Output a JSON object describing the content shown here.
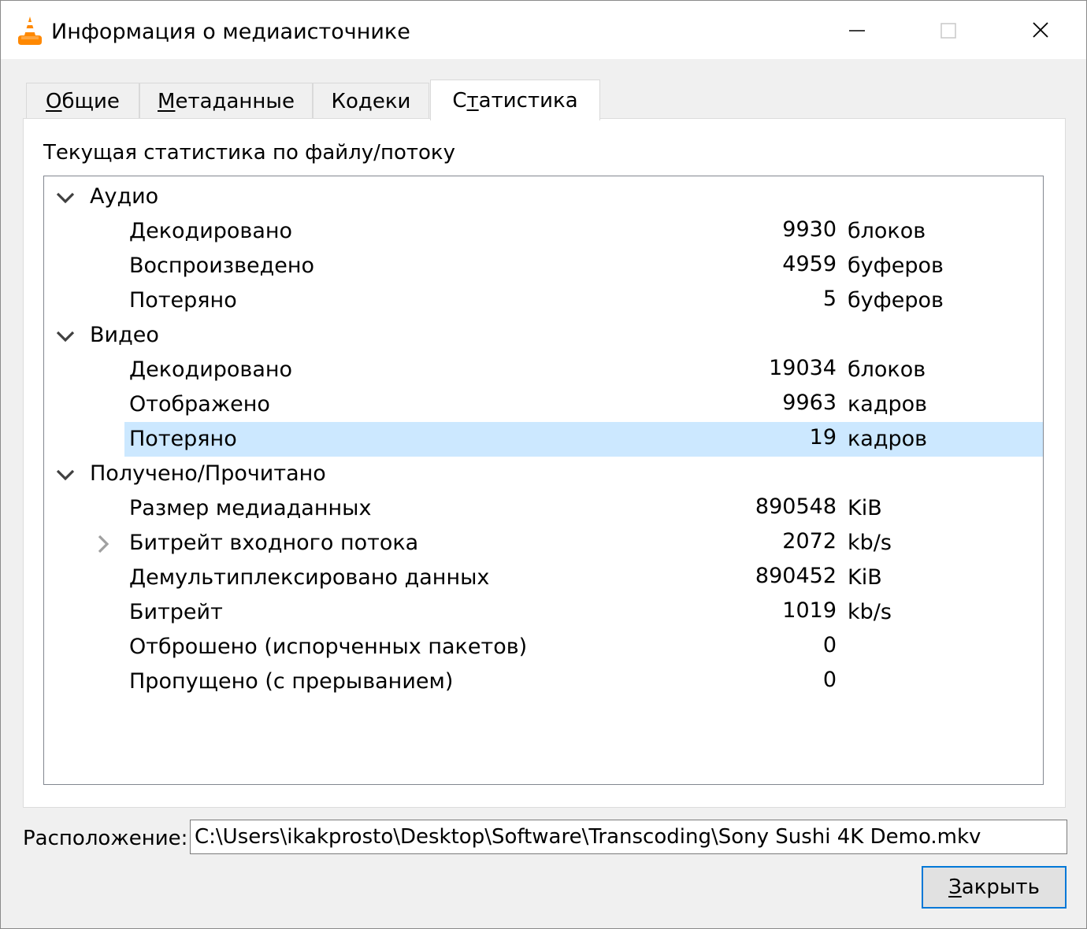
{
  "window": {
    "title": "Информация о медиаисточнике",
    "app_icon": "vlc-cone-icon",
    "buttons": [
      "minimize-icon",
      "maximize-icon",
      "close-icon"
    ]
  },
  "tabs": [
    {
      "mnemonic": "О",
      "rest": "бщие",
      "active": false
    },
    {
      "mnemonic": "М",
      "rest": "етаданные",
      "active": false
    },
    {
      "mnemonic": "",
      "rest": "Кодеки",
      "active": false
    },
    {
      "pre": "С",
      "mnemonic": "т",
      "rest": "атистика",
      "active": true
    }
  ],
  "stats": {
    "heading": "Текущая статистика по файлу/потоку",
    "groups": [
      {
        "label": "Аудио",
        "expanded": true,
        "items": [
          {
            "label": "Декодировано",
            "value": "9930",
            "unit": "блоков"
          },
          {
            "label": "Воспроизведено",
            "value": "4959",
            "unit": "буферов"
          },
          {
            "label": "Потеряно",
            "value": "5",
            "unit": "буферов"
          }
        ]
      },
      {
        "label": "Видео",
        "expanded": true,
        "items": [
          {
            "label": "Декодировано",
            "value": "19034",
            "unit": "блоков"
          },
          {
            "label": "Отображено",
            "value": "9963",
            "unit": "кадров"
          },
          {
            "label": "Потеряно",
            "value": "19",
            "unit": "кадров",
            "selected": true
          }
        ]
      },
      {
        "label": "Получено/Прочитано",
        "expanded": true,
        "items": [
          {
            "label": "Размер медиаданных",
            "value": "890548",
            "unit": "KiB"
          },
          {
            "label": "Битрейт входного потока",
            "value": "2072",
            "unit": "kb/s",
            "collapsed_child": true
          },
          {
            "label": "Демультиплексировано данных",
            "value": "890452",
            "unit": "KiB"
          },
          {
            "label": "Битрейт",
            "value": "1019",
            "unit": "kb/s"
          },
          {
            "label": "Отброшено (испорченных пакетов)",
            "value": "0",
            "unit": ""
          },
          {
            "label": "Пропущено (с прерыванием)",
            "value": "0",
            "unit": ""
          }
        ]
      }
    ]
  },
  "location": {
    "label": "Расположение:",
    "value": "C:\\Users\\ikakprosto\\Desktop\\Software\\Transcoding\\Sony Sushi 4K Demo.mkv"
  },
  "close_button": {
    "mnemonic": "З",
    "rest": "акрыть"
  },
  "colors": {
    "selection": "#cce8ff",
    "focus_border": "#0078d7",
    "tree_border": "#828790"
  }
}
